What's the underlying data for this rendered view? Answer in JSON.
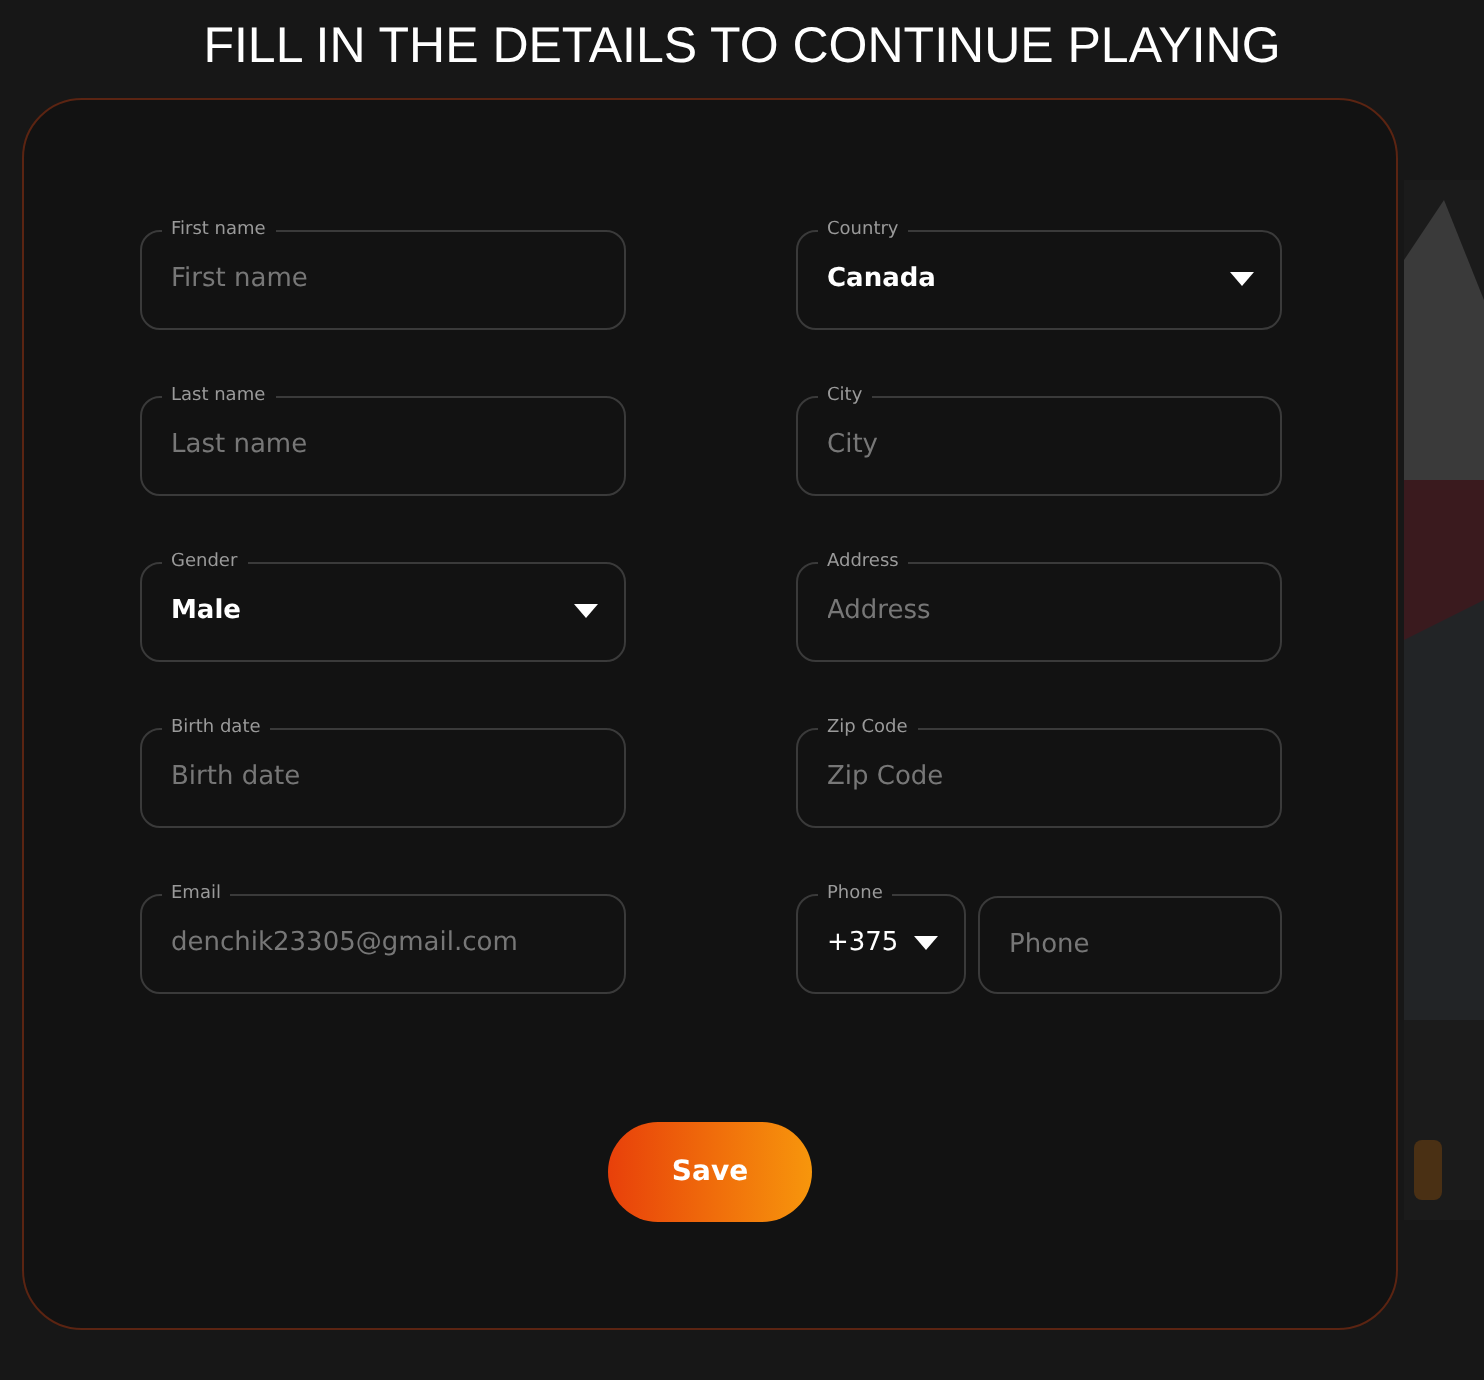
{
  "title": "FILL IN THE DETAILS TO CONTINUE PLAYING",
  "fields": [
    {
      "kind": "text",
      "label": "First name",
      "placeholder": "First name"
    },
    {
      "kind": "select",
      "label": "Country",
      "value": "Canada"
    },
    {
      "kind": "text",
      "label": "Last name",
      "placeholder": "Last name"
    },
    {
      "kind": "text",
      "label": "City",
      "placeholder": "City"
    },
    {
      "kind": "select",
      "label": "Gender",
      "value": "Male"
    },
    {
      "kind": "text",
      "label": "Address",
      "placeholder": "Address"
    },
    {
      "kind": "text",
      "label": "Birth date",
      "placeholder": "Birth date"
    },
    {
      "kind": "text",
      "label": "Zip Code",
      "placeholder": "Zip Code"
    },
    {
      "kind": "text",
      "label": "Email",
      "placeholder": "denchik23305@gmail.com"
    },
    {
      "kind": "phone",
      "label": "Phone",
      "code": "+375",
      "placeholder": "Phone"
    }
  ],
  "save_button": "Save"
}
